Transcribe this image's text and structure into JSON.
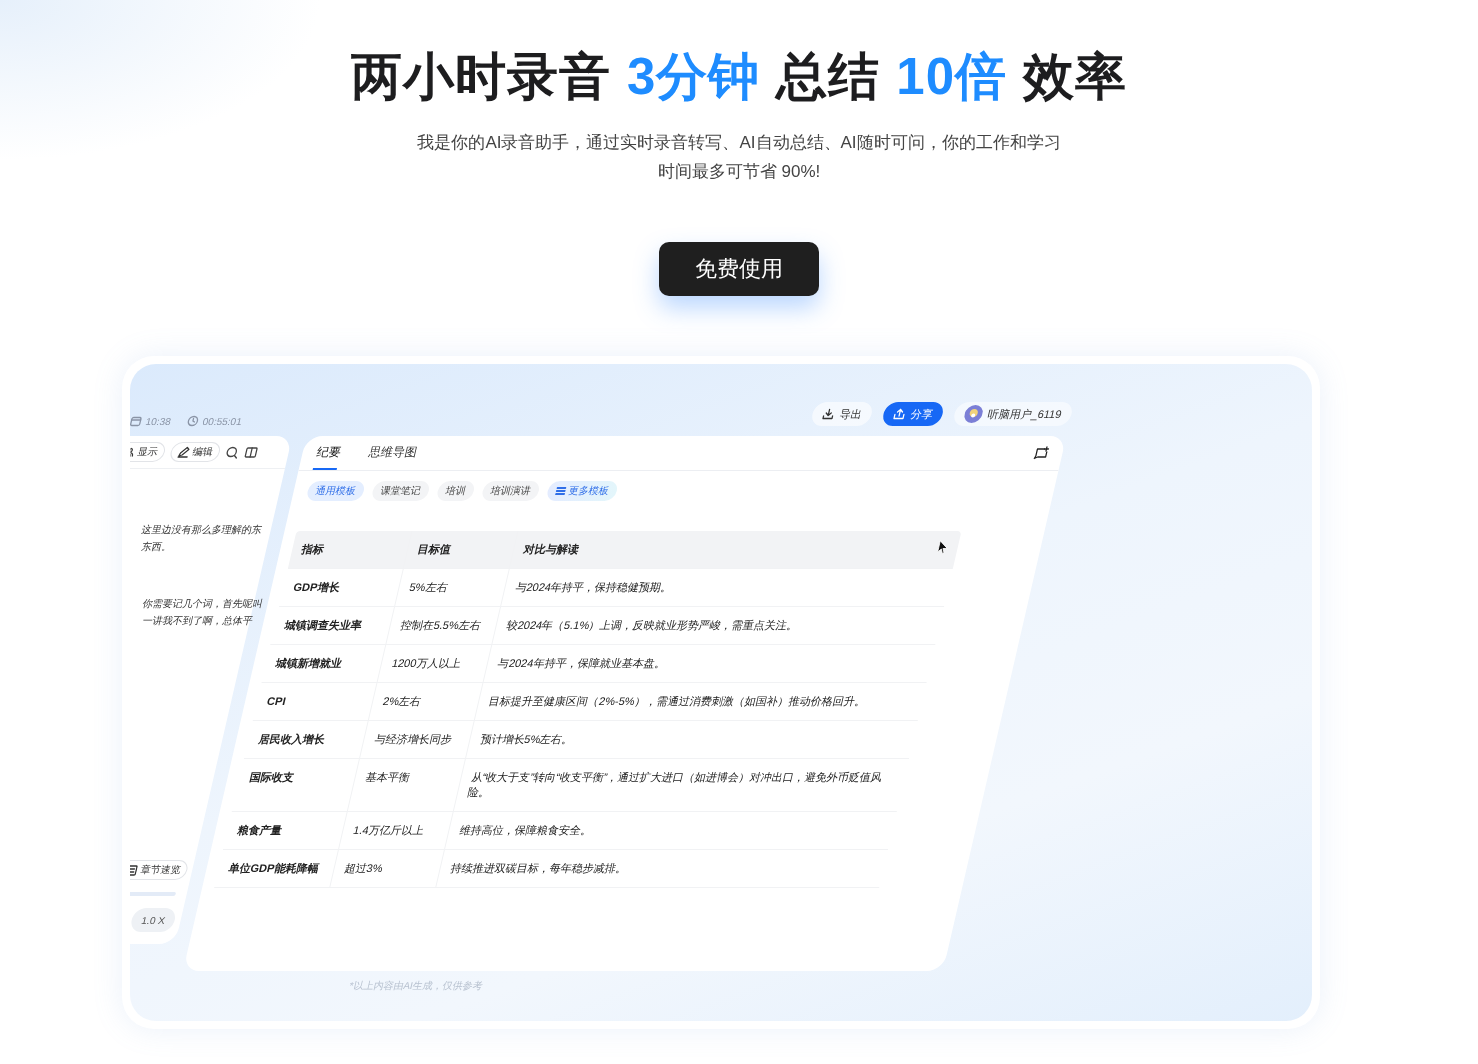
{
  "hero": {
    "headline": [
      {
        "text": "两小时录音",
        "accent": false
      },
      {
        "text": "3分钟",
        "accent": true
      },
      {
        "text": "总结",
        "accent": false
      },
      {
        "text": "10倍",
        "accent": true
      },
      {
        "text": "效率",
        "accent": false
      }
    ],
    "subtitle": "我是你的AI录音助手，通过实时录音转写、AI自动总结、AI随时可问，你的工作和学习时间最多可节省 90%!",
    "cta": "免费使用"
  },
  "app": {
    "meta": [
      {
        "kind": "date",
        "text": "10:38"
      },
      {
        "kind": "duration",
        "text": "00:55:01"
      }
    ],
    "actions": [
      {
        "kind": "export",
        "label": "导出"
      },
      {
        "kind": "share",
        "label": "分享"
      }
    ],
    "user": {
      "name": "听脑用户_6119"
    },
    "transcript": {
      "tools": [
        {
          "kind": "display",
          "label": "显示"
        },
        {
          "kind": "edit",
          "label": "编辑"
        }
      ],
      "lines": [
        "这里边没有那么多理解的东",
        "东西。",
        "你需要记几个词，首先呢叫",
        "一讲我不到了啊，总体平"
      ],
      "chapter_button": "章节速览",
      "speed": "1.0 X"
    },
    "summary": {
      "tabs": [
        {
          "label": "纪要",
          "selected": true
        },
        {
          "label": "思维导图",
          "selected": false
        }
      ],
      "templates": [
        {
          "label": "通用模板",
          "kind": "template",
          "selected": true
        },
        {
          "label": "课堂笔记",
          "kind": "template",
          "selected": false
        },
        {
          "label": "培训",
          "kind": "template",
          "selected": false
        },
        {
          "label": "培训演讲",
          "kind": "template",
          "selected": false
        },
        {
          "label": "更多模板",
          "kind": "more",
          "selected": false
        }
      ],
      "table": {
        "columns": [
          "指标",
          "目标值",
          "对比与解读"
        ],
        "rows": [
          [
            "GDP增长",
            "5%左右",
            "与2024年持平，保持稳健预期。"
          ],
          [
            "城镇调查失业率",
            "控制在5.5%左右",
            "较2024年（5.1%）上调，反映就业形势严峻，需重点关注。"
          ],
          [
            "城镇新增就业",
            "1200万人以上",
            "与2024年持平，保障就业基本盘。"
          ],
          [
            "CPI",
            "2%左右",
            "目标提升至健康区间（2%-5%），需通过消费刺激（如国补）推动价格回升。"
          ],
          [
            "居民收入增长",
            "与经济增长同步",
            "预计增长5%左右。"
          ],
          [
            "国际收支",
            "基本平衡",
            "从“收大于支”转向“收支平衡”，通过扩大进口（如进博会）对冲出口，避免外币贬值风险。"
          ],
          [
            "粮食产量",
            "1.4万亿斤以上",
            "维持高位，保障粮食安全。"
          ],
          [
            "单位GDP能耗降幅",
            "超过3%",
            "持续推进双碳目标，每年稳步减排。"
          ]
        ]
      },
      "disclaimer": "*以上内容由AI生成，仅供参考"
    }
  }
}
